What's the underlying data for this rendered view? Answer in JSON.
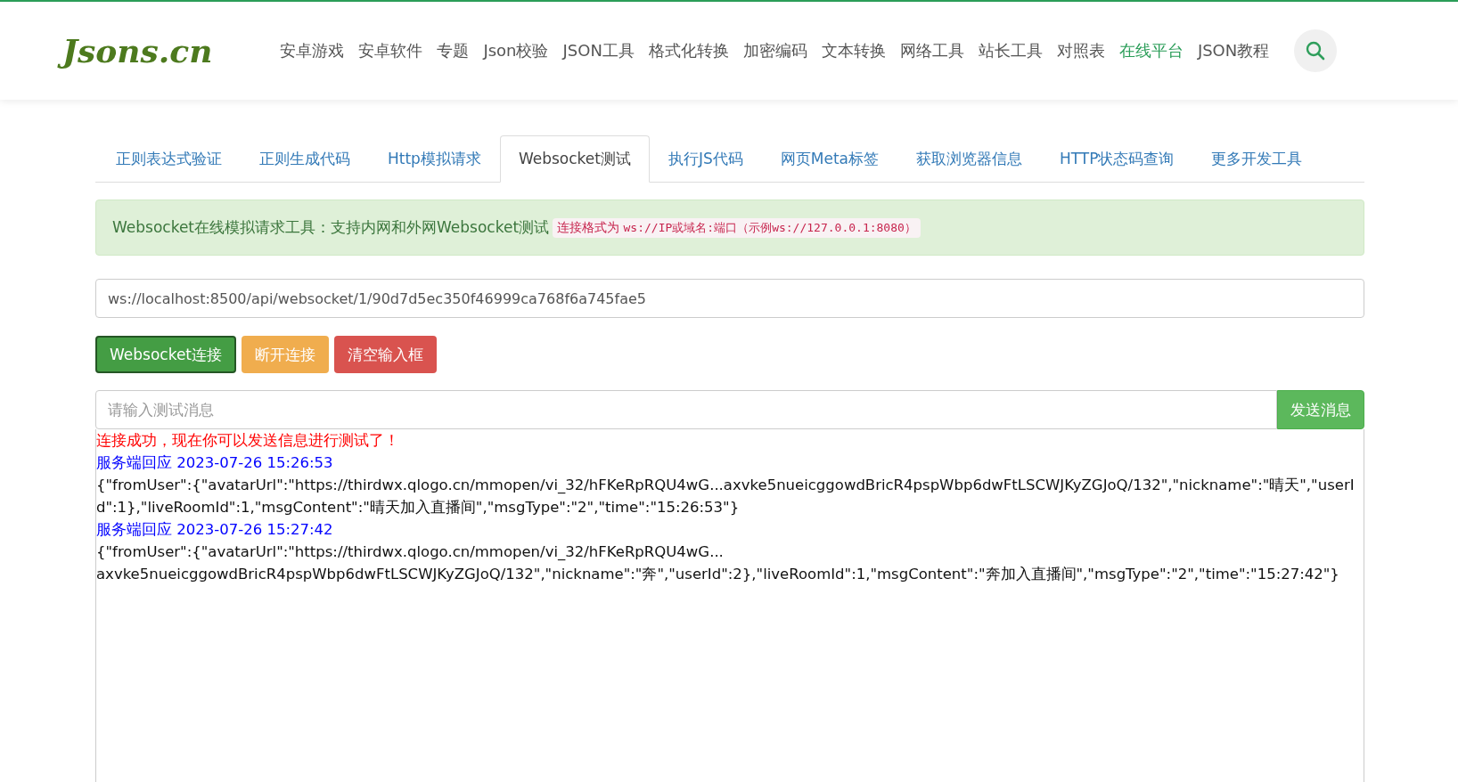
{
  "logo": "Jsons.cn",
  "nav": [
    {
      "label": "安卓游戏",
      "selected": false
    },
    {
      "label": "安卓软件",
      "selected": false
    },
    {
      "label": "专题",
      "selected": false
    },
    {
      "label": "Json校验",
      "selected": false
    },
    {
      "label": "JSON工具",
      "selected": false
    },
    {
      "label": "格式化转换",
      "selected": false
    },
    {
      "label": "加密编码",
      "selected": false
    },
    {
      "label": "文本转换",
      "selected": false
    },
    {
      "label": "网络工具",
      "selected": false
    },
    {
      "label": "站长工具",
      "selected": false
    },
    {
      "label": "对照表",
      "selected": false
    },
    {
      "label": "在线平台",
      "selected": true
    },
    {
      "label": "JSON教程",
      "selected": false
    }
  ],
  "tabs": [
    {
      "label": "正则表达式验证",
      "selected": false
    },
    {
      "label": "正则生成代码",
      "selected": false
    },
    {
      "label": "Http模拟请求",
      "selected": false
    },
    {
      "label": "Websocket测试",
      "selected": true
    },
    {
      "label": "执行JS代码",
      "selected": false
    },
    {
      "label": "网页Meta标签",
      "selected": false
    },
    {
      "label": "获取浏览器信息",
      "selected": false
    },
    {
      "label": "HTTP状态码查询",
      "selected": false
    },
    {
      "label": "更多开发工具",
      "selected": false
    }
  ],
  "notice": {
    "text": "Websocket在线模拟请求工具：支持内网和外网Websocket测试",
    "format_label": "连接格式为",
    "format_code": "ws://IP或域名:端口（示例ws://127.0.0.1:8080）"
  },
  "url_field": {
    "value": "ws://localhost:8500/api/websocket/1/90d7d5ec350f46999ca768f6a745fae5"
  },
  "buttons": [
    {
      "label": "Websocket连接",
      "kind": "connect"
    },
    {
      "label": "断开连接",
      "kind": "disconnect"
    },
    {
      "label": "清空输入框",
      "kind": "clear"
    }
  ],
  "message_field": {
    "placeholder": "请输入测试消息"
  },
  "send_button": "发送消息",
  "log": [
    {
      "kind": "status",
      "text": "连接成功，现在你可以发送信息进行测试了！"
    },
    {
      "kind": "header",
      "text": "服务端回应 2023-07-26 15:26:53"
    },
    {
      "kind": "message",
      "text": "{\"fromUser\":{\"avatarUrl\":\"https://thirdwx.qlogo.cn/mmopen/vi_32/hFKeRpRQU4wG...axvke5nueicggowdBricR4pspWbp6dwFtLSCWJKyZGJoQ/132\",\"nickname\":\"晴天\",\"userId\":1},\"liveRoomId\":1,\"msgContent\":\"晴天加入直播间\",\"msgType\":\"2\",\"time\":\"15:26:53\"}"
    },
    {
      "kind": "header",
      "text": "服务端回应 2023-07-26 15:27:42"
    },
    {
      "kind": "message",
      "text": "{\"fromUser\":{\"avatarUrl\":\"https://thirdwx.qlogo.cn/mmopen/vi_32/hFKeRpRQU4wG...\naxvke5nueicggowdBricR4pspWbp6dwFtLSCWJKyZGJoQ/132\",\"nickname\":\"奔\",\"userId\":2},\"liveRoomId\":1,\"msgContent\":\"奔加入直播间\",\"msgType\":\"2\",\"time\":\"15:27:42\"}"
    }
  ]
}
